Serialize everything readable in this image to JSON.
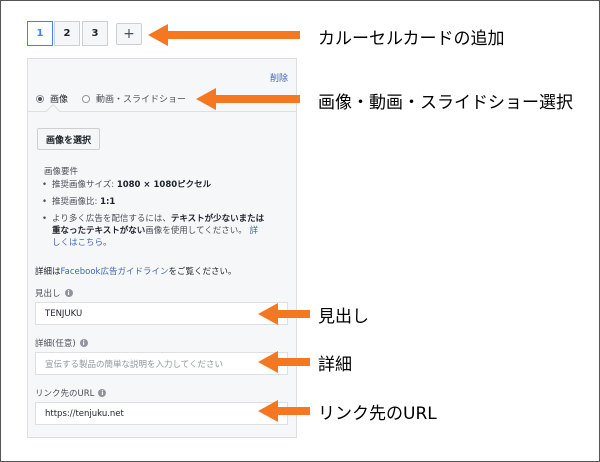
{
  "tabs": [
    "1",
    "2",
    "3"
  ],
  "add_button": "+",
  "panel": {
    "delete_link": "削除",
    "radio_image": "画像",
    "radio_video": "動画・スライドショー",
    "select_image_button": "画像を選択",
    "requirements_title": "画像要件",
    "requirements": {
      "size_label": "推奨画像サイズ: ",
      "size_value": "1080 × 1080ピクセル",
      "ratio_label": "推奨画像比: ",
      "ratio_value": "1:1",
      "text_line1_a": "より多く広告を配信するには、",
      "text_line1_b": "テキストが少ないまたは",
      "text_line2_a": "重なったテキストがない",
      "text_line2_b": "画像を使用してください。",
      "text_line2_link": "詳",
      "text_line3_link": "しくはこちら",
      "text_line3_end": "。"
    },
    "guide_prefix": "詳細は",
    "guide_link": "Facebook広告ガイドライン",
    "guide_suffix": "をご覧ください。",
    "headline_label": "見出し",
    "headline_value": "TENJUKU",
    "description_label": "詳細(任意)",
    "description_placeholder": "宣伝する製品の簡単な説明を入力してください",
    "url_label": "リンク先のURL",
    "url_value": "https://tenjuku.net"
  },
  "annotations": {
    "add_card": "カルーセルカードの追加",
    "media_select": "画像・動画・スライドショー選択",
    "headline": "見出し",
    "description": "詳細",
    "url": "リンク先のURL"
  },
  "colors": {
    "arrow": "#f47721",
    "accent": "#4080ff",
    "link": "#4267b2"
  },
  "icons": {
    "info": "info-circle-icon",
    "arrow": "left-arrow-icon"
  }
}
